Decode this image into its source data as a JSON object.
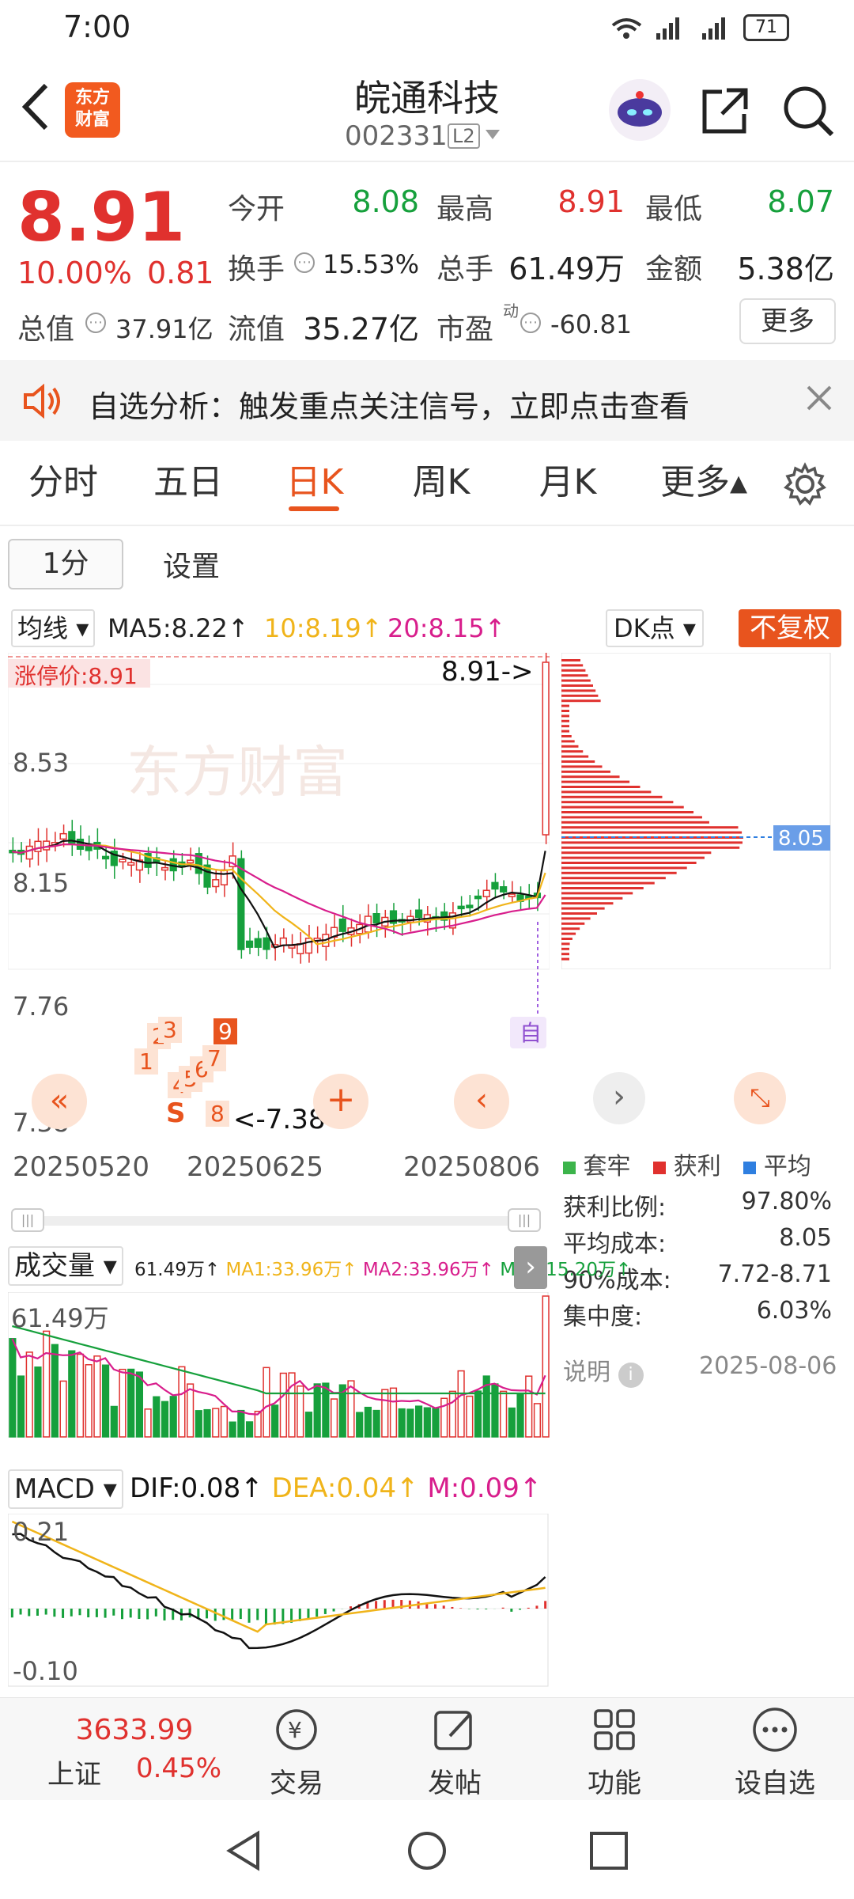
{
  "status": {
    "time": "7:00",
    "battery": "71"
  },
  "header": {
    "logo_line1": "东方",
    "logo_line2": "财富",
    "stock_name": "皖通科技",
    "stock_code": "002331",
    "level_badge": "L2"
  },
  "quote": {
    "price": "8.91",
    "change_pct": "10.00%",
    "change_amt": "0.81",
    "open_label": "今开",
    "open": "8.08",
    "high_label": "最高",
    "high": "8.91",
    "low_label": "最低",
    "low": "8.07",
    "turnover_label": "换手",
    "turnover": "15.53%",
    "volume_label": "总手",
    "volume": "61.49万",
    "amount_label": "金额",
    "amount": "5.38亿",
    "mktcap_label": "总值",
    "mktcap": "37.91亿",
    "float_label": "流值",
    "float_cap": "35.27亿",
    "pe_label": "市盈",
    "pe_super": "动",
    "pe": "-60.81",
    "more": "更多"
  },
  "banner": {
    "text": "自选分析：触发重点关注信号，立即点击查看"
  },
  "tabs": [
    "分时",
    "五日",
    "日K",
    "周K",
    "月K",
    "更多▴"
  ],
  "subtabs": {
    "period": "1分",
    "settings": "设置"
  },
  "kline": {
    "ma_selector": "均线",
    "ma5": "MA5:8.22↑",
    "ma10": "10:8.19↑",
    "ma20": "20:8.15↑",
    "dk": "DK点",
    "fq": "不复权",
    "limit_label": "涨停价:8.91",
    "y_top": "8.91",
    "y_mid1": "8.53",
    "y_mid2": "8.15",
    "y_mid3": "7.76",
    "y_low": "7.38",
    "max_marker": "8.91->",
    "min_marker": "<-7.38",
    "dates": [
      "20250520",
      "20250625",
      "20250806"
    ],
    "self_tag": "自",
    "watermark": "东方财富"
  },
  "chip": {
    "price_tag": "8.05",
    "legend": [
      "套牢",
      "获利",
      "平均"
    ],
    "legend_colors": [
      "#3cb44b",
      "#e0312e",
      "#2f7fe0"
    ],
    "rows": [
      {
        "k": "获利比例:",
        "v": "97.80%"
      },
      {
        "k": "平均成本:",
        "v": "8.05"
      },
      {
        "k": "90%成本:",
        "v": "7.72-8.71"
      },
      {
        "k": "集中度:",
        "v": "6.03%"
      }
    ],
    "note": "说明",
    "date": "2025-08-06"
  },
  "volume": {
    "selector": "成交量",
    "cur": "61.49万↑",
    "ma1": "MA1:33.96万↑",
    "ma2": "MA2:33.96万↑",
    "ma3": "MA3:15.20万↑",
    "top": "61.49万"
  },
  "macd": {
    "selector": "MACD",
    "dif": "DIF:0.08↑",
    "dea": "DEA:0.04↑",
    "m": "M:0.09↑",
    "top": "0.21",
    "bottom": "-0.10"
  },
  "bottom": {
    "index_value": "3633.99",
    "index_name": "上证",
    "index_pct": "0.45%",
    "items": [
      "交易",
      "发帖",
      "功能",
      "设自选"
    ]
  }
}
